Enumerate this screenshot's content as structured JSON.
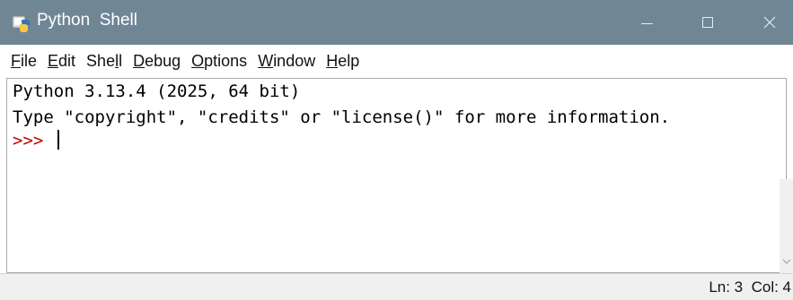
{
  "window": {
    "title": "Python  Shell",
    "icon": "python-idle-icon",
    "controls": {
      "minimize": "—",
      "maximize": "□",
      "close": "✕"
    }
  },
  "menu": [
    {
      "label_u": "F",
      "label_rest": "ile"
    },
    {
      "label_u": "E",
      "label_rest": "dit"
    },
    {
      "label_pre": "She",
      "label_u": "l",
      "label_rest": "l"
    },
    {
      "label_u": "D",
      "label_rest": "ebug"
    },
    {
      "label_u": "O",
      "label_rest": "ptions"
    },
    {
      "label_u": "W",
      "label_rest": "indow"
    },
    {
      "label_u": "H",
      "label_rest": "elp"
    }
  ],
  "shell": {
    "line1": "Python 3.13.4 (2025, 64 bit)",
    "line2": "Type \"copyright\", \"credits\" or \"license()\" for more information.",
    "prompt": ">>>"
  },
  "status": {
    "text": "Ln: 3  Col: 4"
  },
  "colors": {
    "titlebar": "#6f8695",
    "prompt": "#c00000"
  }
}
